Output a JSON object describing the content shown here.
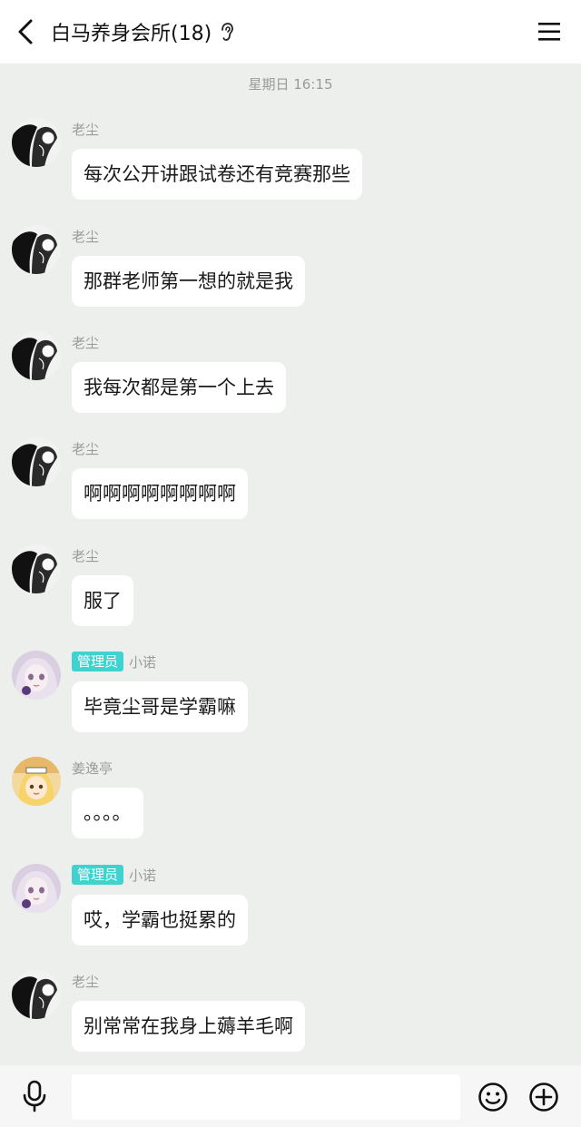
{
  "header": {
    "title": "白马养身会所(18)",
    "back_icon": "chevron-left-icon",
    "ear_icon": "ear-icon",
    "menu_icon": "hamburger-menu-icon"
  },
  "timestamp": "星期日 16:15",
  "messages": [
    {
      "sender": "老尘",
      "badge": "",
      "avatar": "manga-couple",
      "text": "每次公开讲跟试卷还有竞赛那些"
    },
    {
      "sender": "老尘",
      "badge": "",
      "avatar": "manga-couple",
      "text": "那群老师第一想的就是我"
    },
    {
      "sender": "老尘",
      "badge": "",
      "avatar": "manga-couple",
      "text": "我每次都是第一个上去"
    },
    {
      "sender": "老尘",
      "badge": "",
      "avatar": "manga-couple",
      "text": "啊啊啊啊啊啊啊啊"
    },
    {
      "sender": "老尘",
      "badge": "",
      "avatar": "manga-couple",
      "text": "服了"
    },
    {
      "sender": "小诺",
      "badge": "管理员",
      "avatar": "anime-girl-pink",
      "text": "毕竟尘哥是学霸嘛"
    },
    {
      "sender": "姜逸亭",
      "badge": "",
      "avatar": "anime-blonde",
      "text": "。。。。"
    },
    {
      "sender": "小诺",
      "badge": "管理员",
      "avatar": "anime-girl-pink",
      "text": "哎，学霸也挺累的"
    },
    {
      "sender": "老尘",
      "badge": "",
      "avatar": "manga-couple",
      "text": "别常常在我身上薅羊毛啊"
    }
  ],
  "bottom_bar": {
    "mic_icon": "microphone-icon",
    "input_value": "",
    "emoji_icon": "emoji-icon",
    "plus_icon": "plus-circle-icon"
  },
  "colors": {
    "background": "#ecefec",
    "bubble": "#ffffff",
    "admin_badge": "#3fd2cf"
  }
}
